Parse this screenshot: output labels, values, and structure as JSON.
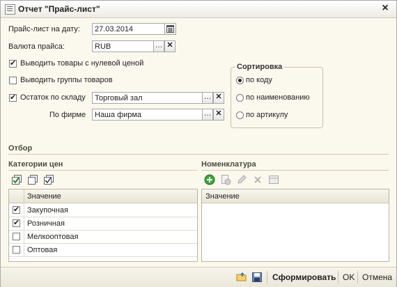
{
  "window": {
    "title": "Отчет \"Прайс-лист\""
  },
  "form": {
    "date_label": "Прайс-лист на дату:",
    "date_value": "27.03.2014",
    "currency_label": "Валюта прайса:",
    "currency_value": "RUB",
    "zero_price_label": "Выводить товары с нулевой ценой",
    "groups_label": "Выводить группы товаров",
    "stock_label": "Остаток по складу",
    "stock_value": "Торговый зал",
    "company_label": "По фирме",
    "company_value": "Наша фирма",
    "zero_price_checked": true,
    "groups_checked": false,
    "stock_checked": true
  },
  "sorting": {
    "title": "Сортировка",
    "options": [
      "по коду",
      "по наименованию",
      "по артикулу"
    ],
    "selected": 0
  },
  "filter": {
    "title": "Отбор"
  },
  "price_categories": {
    "title": "Категории цен",
    "column": "Значение",
    "rows": [
      {
        "name": "Закупочная",
        "checked": true
      },
      {
        "name": "Розничная",
        "checked": true
      },
      {
        "name": "Мелкооптовая",
        "checked": false
      },
      {
        "name": "Оптовая",
        "checked": false
      }
    ]
  },
  "nomenclature": {
    "title": "Номенклатура",
    "column": "Значение"
  },
  "footer": {
    "generate": "Сформировать",
    "ok": "OK",
    "cancel": "Отмена"
  }
}
